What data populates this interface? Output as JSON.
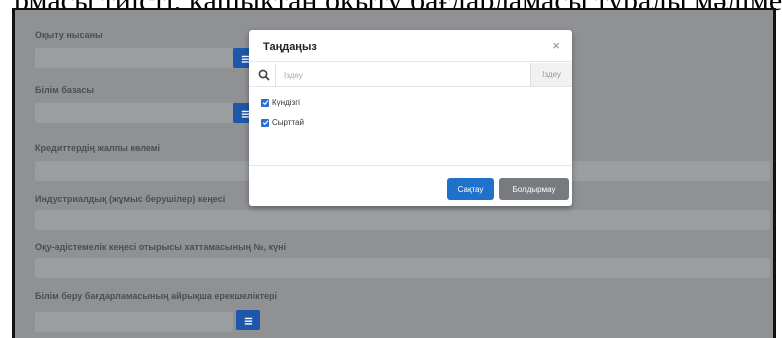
{
  "header_text": "рмасы тиісті, қашықтан оқыту бағдарламасы туралы мәліметтер",
  "form": {
    "labels": [
      "Оқыту нысаны",
      "Білім базасы",
      "Кредиттердің жалпы көлемі",
      "Индустриалдық (жұмыс берушілер) кеңесі",
      "Оқу-әдістемелік кеңесі отырысы хаттамасының №, күні",
      "Білім беру бағдарламасының айрықша ерекшеліктері"
    ]
  },
  "modal": {
    "title": "Таңдаңыз",
    "close_symbol": "×",
    "search_placeholder": "Іздеу",
    "search_button": "Іздеу",
    "options": [
      {
        "label": "Күндізгі",
        "checked": true
      },
      {
        "label": "Сырттай",
        "checked": true
      }
    ],
    "save_label": "Сақтау",
    "cancel_label": "Болдырмау"
  },
  "colors": {
    "primary": "#1f72c9",
    "secondary": "#777a7e",
    "overlay_bg": "#8f9194",
    "side_button": "#1f57a8"
  },
  "icons": {
    "search": "search-icon",
    "side_button": "list-icon",
    "checkbox": "check-icon"
  }
}
